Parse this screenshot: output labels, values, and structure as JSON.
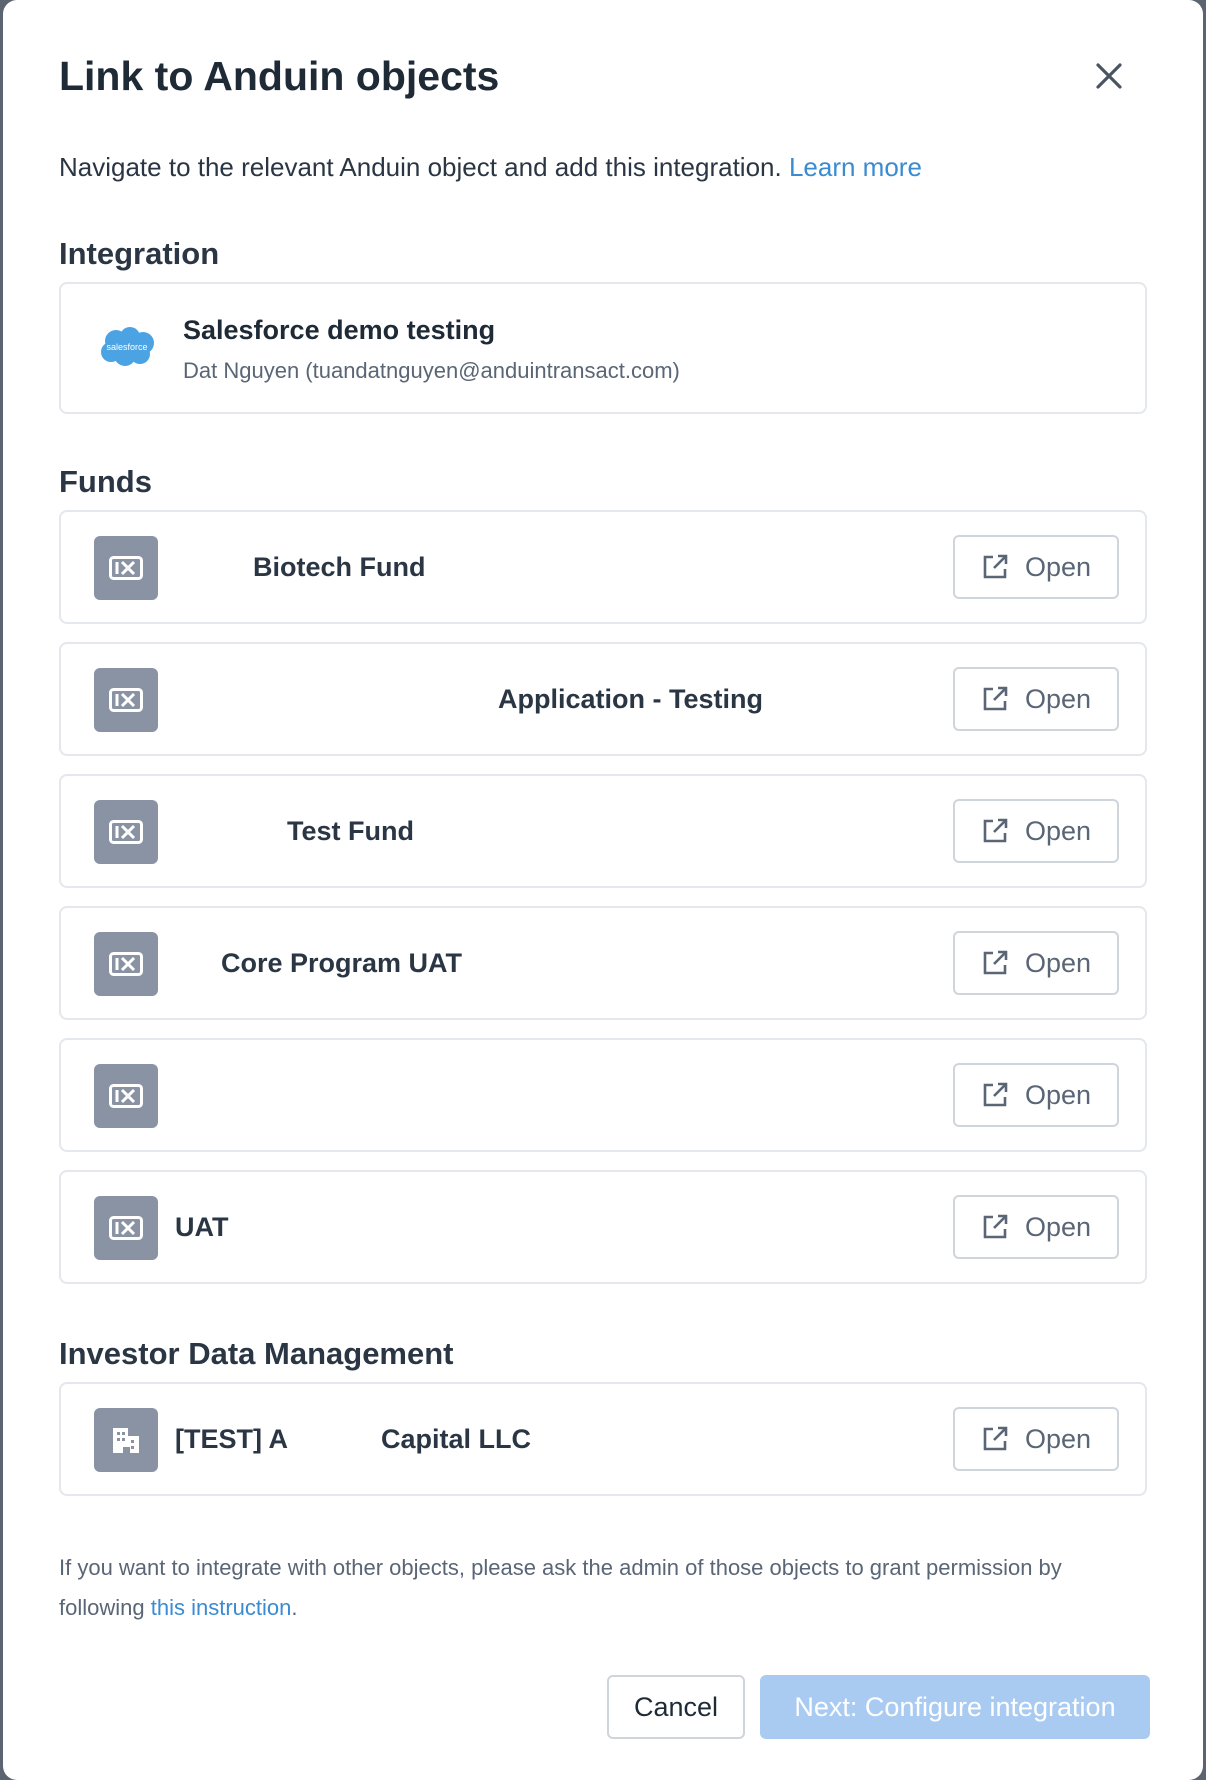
{
  "modal": {
    "title": "Link to Anduin objects",
    "intro_text": "Navigate to the relevant Anduin object and add this integration.",
    "learn_more": "Learn more"
  },
  "integration": {
    "heading": "Integration",
    "name": "Salesforce demo testing",
    "owner": "Dat Nguyen (tuandatnguyen@anduintransact.com)",
    "logo_text": "salesforce",
    "logo_color": "#4ba3e3"
  },
  "funds": {
    "heading": "Funds",
    "items": [
      {
        "label": "Biotech Fund",
        "action": "Open"
      },
      {
        "label": "Application - Testing",
        "action": "Open"
      },
      {
        "label": "Test Fund",
        "action": "Open"
      },
      {
        "label": "Core Program UAT",
        "action": "Open"
      },
      {
        "label": "",
        "action": "Open"
      },
      {
        "label": "UAT",
        "action": "Open"
      }
    ]
  },
  "idm": {
    "heading": "Investor Data Management",
    "items": [
      {
        "label_part1": "[TEST] A",
        "label_part2": "Capital LLC",
        "action": "Open"
      }
    ]
  },
  "footer": {
    "note_prefix": "If you want to integrate with other objects, please ask the admin of those objects to grant permission by following",
    "note_link": "this instruction",
    "note_suffix": ".",
    "cancel_label": "Cancel",
    "next_label": "Next: Configure integration"
  },
  "colors": {
    "accent_link": "#3a8bd1",
    "primary_disabled": "#a9cbf2",
    "fund_icon_bg": "#8a93a3"
  }
}
